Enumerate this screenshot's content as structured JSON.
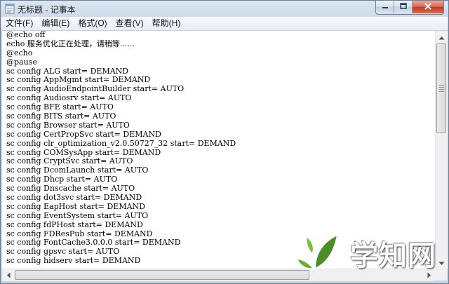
{
  "window": {
    "title": "无标题 - 记事本"
  },
  "menu": [
    {
      "label": "文件(F)"
    },
    {
      "label": "编辑(E)"
    },
    {
      "label": "格式(O)"
    },
    {
      "label": "查看(V)"
    },
    {
      "label": "帮助(H)"
    }
  ],
  "editor": {
    "lines": [
      "@echo off",
      "echo 服务优化正在处理，请稍等......",
      "@echo",
      "@pause",
      "sc config ALG start= DEMAND",
      "sc config AppMgmt start= DEMAND",
      "sc config AudioEndpointBuilder start= AUTO",
      "sc config Audiosrv start= AUTO",
      "sc config BFE start= AUTO",
      "sc config BITS start= AUTO",
      "sc config Browser start= AUTO",
      "sc config CertPropSvc start= DEMAND",
      "sc config clr_optimization_v2.0.50727_32 start= DEMAND",
      "sc config COMSysApp start= DEMAND",
      "sc config CryptSvc start= AUTO",
      "sc config DcomLaunch start= AUTO",
      "sc config Dhcp start= AUTO",
      "sc config Dnscache start= AUTO",
      "sc config dot3svc start= DEMAND",
      "sc config EapHost start= DEMAND",
      "sc config EventSystem start= AUTO",
      "sc config fdPHost start= DEMAND",
      "sc config FDResPub start= DEMAND",
      "sc config FontCache3.0.0.0 start= DEMAND",
      "sc config gpsvc start= AUTO",
      "sc config hidserv start= DEMAND"
    ]
  },
  "watermark": {
    "text": "学知网",
    "leaf_color": "#4a8f2a"
  },
  "icons": {
    "app": "notepad-icon",
    "minimize": "minimize-icon",
    "maximize": "maximize-icon",
    "close": "close-icon"
  }
}
